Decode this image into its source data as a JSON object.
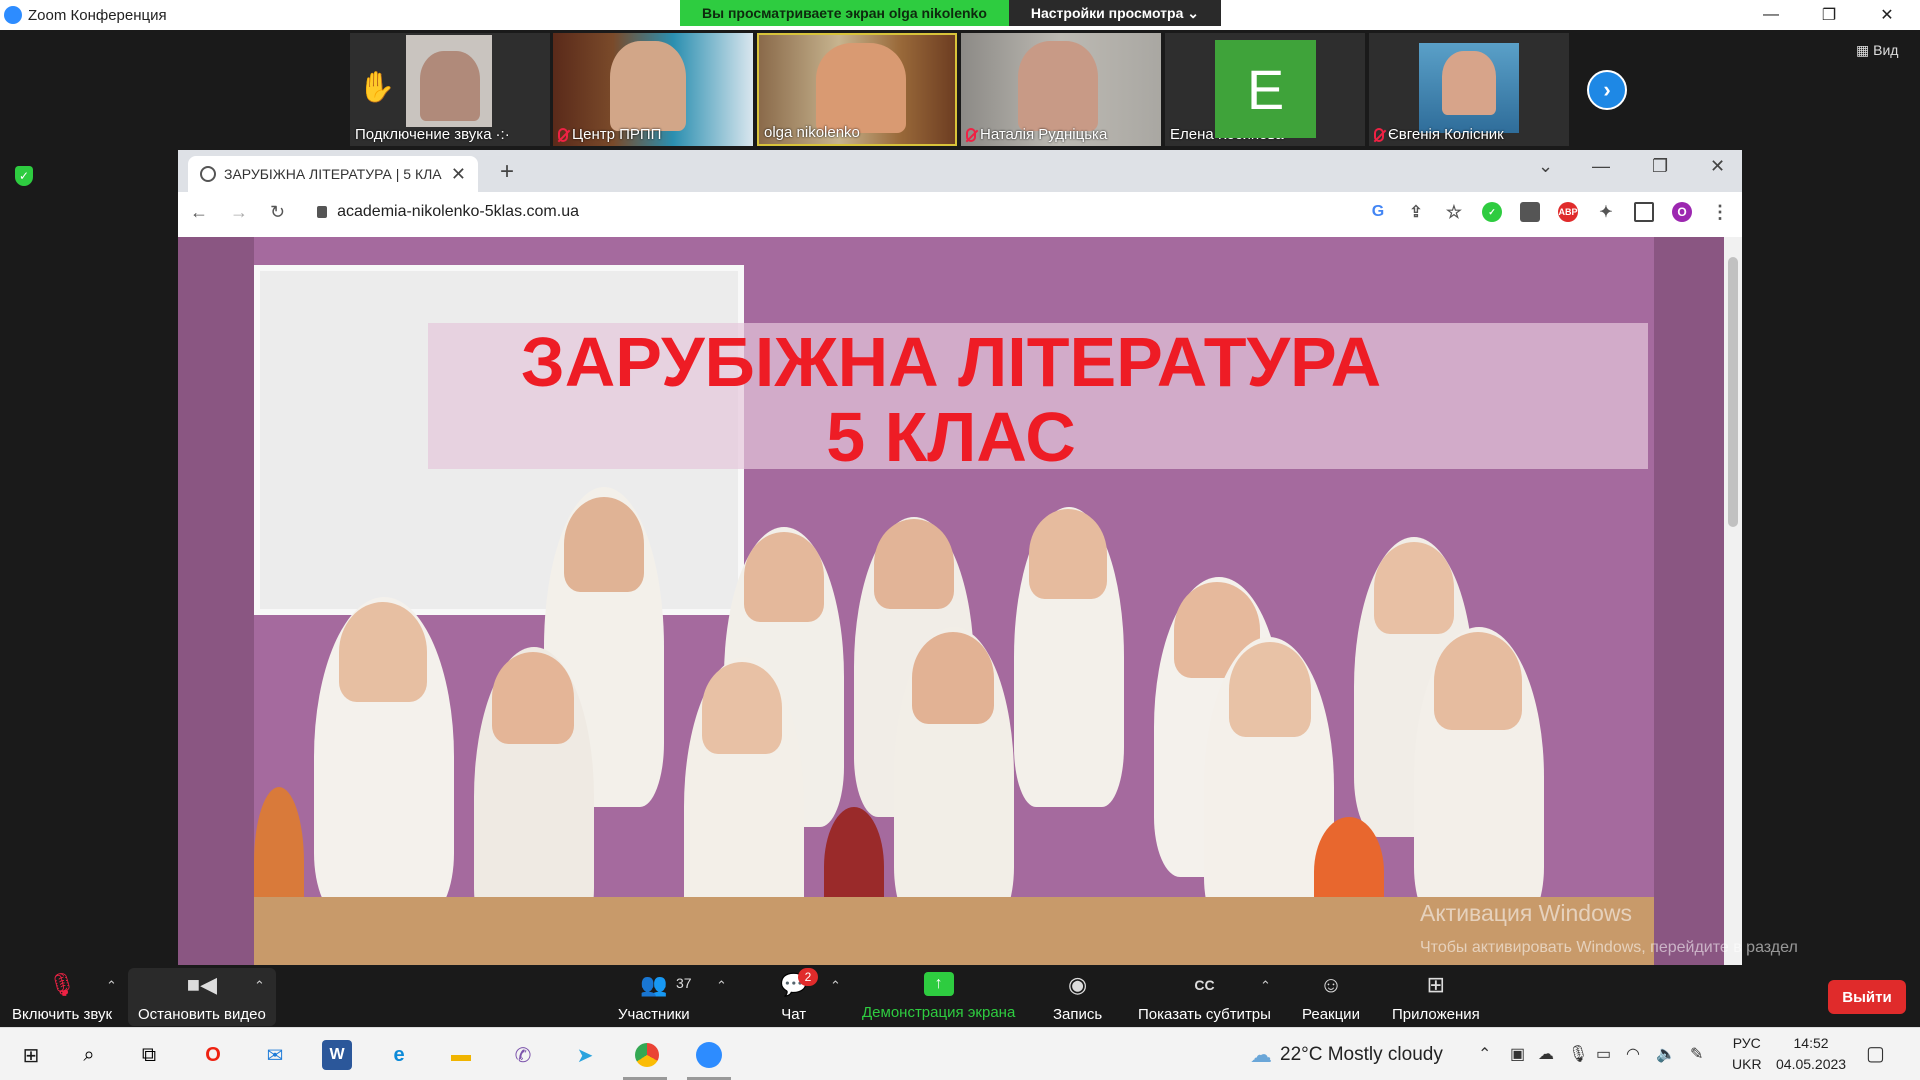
{
  "zoom": {
    "window_title": "Zoom Конференция",
    "share_banner": "Вы просматриваете экран olga nikolenko",
    "view_settings": "Настройки просмотра ⌄",
    "view_button": "Вид"
  },
  "participants": [
    {
      "name": "Подключение звука",
      "muted": false
    },
    {
      "name": "Центр ПРПП",
      "muted": true
    },
    {
      "name": "olga nikolenko",
      "muted": false
    },
    {
      "name": "Наталія Рудніцька",
      "muted": true
    },
    {
      "name": "Елена Косинова",
      "muted": false,
      "initial": "E"
    },
    {
      "name": "Євгенія Колісник",
      "muted": true
    }
  ],
  "browser": {
    "tab_title": "ЗАРУБІЖНА ЛІТЕРАТУРА | 5 КЛА",
    "url": "academia-nikolenko-5klas.com.ua",
    "profile_initial": "O",
    "abp_label": "ABP"
  },
  "page": {
    "headline_1": "ЗАРУБІЖНА ЛІТЕРАТУРА",
    "headline_2": "5 КЛАС"
  },
  "watermark": {
    "title": "Активация Windows",
    "text": "Чтобы активировать Windows, перейдите в раздел \"Параметры\"."
  },
  "toolbar": {
    "unmute": "Включить звук",
    "stop_video": "Остановить видео",
    "participants": "Участники",
    "participants_count": "37",
    "chat": "Чат",
    "chat_badge": "2",
    "share": "Демонстрация экрана",
    "record": "Запись",
    "captions": "Показать субтитры",
    "reactions": "Реакции",
    "apps": "Приложения",
    "leave": "Выйти"
  },
  "taskbar": {
    "weather": "22°C  Mostly cloudy",
    "lang_top": "РУС",
    "lang_bottom": "UKR",
    "time": "14:52",
    "date": "04.05.2023"
  }
}
